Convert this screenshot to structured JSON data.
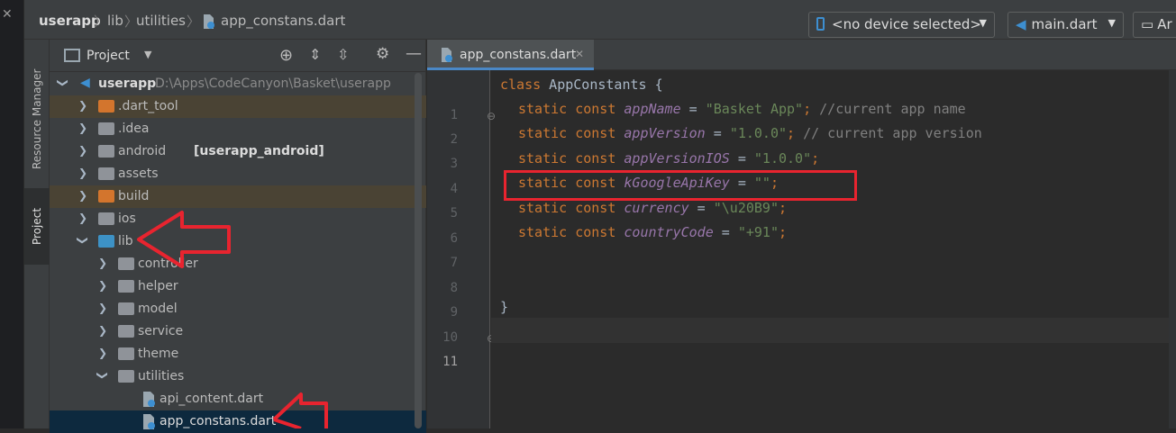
{
  "breadcrumb": {
    "items": [
      "userapp",
      "lib",
      "utilities",
      "app_constans.dart"
    ]
  },
  "toolbar": {
    "device_label": "<no device selected>",
    "config_label": "main.dart",
    "extra_label": "Ar"
  },
  "side_tabs": {
    "resource_manager": "Resource Manager",
    "project": "Project"
  },
  "project_panel": {
    "title": "Project",
    "root": {
      "name": "userapp",
      "path": "D:\\Apps\\CodeCanyon\\Basket\\userapp"
    },
    "items": [
      {
        "label": ".dart_tool",
        "suffix": ""
      },
      {
        "label": ".idea",
        "suffix": ""
      },
      {
        "label": "android",
        "suffix": "[userapp_android]"
      },
      {
        "label": "assets",
        "suffix": ""
      },
      {
        "label": "build",
        "suffix": ""
      },
      {
        "label": "ios",
        "suffix": ""
      },
      {
        "label": "lib",
        "suffix": ""
      },
      {
        "label": "controller",
        "suffix": ""
      },
      {
        "label": "helper",
        "suffix": ""
      },
      {
        "label": "model",
        "suffix": ""
      },
      {
        "label": "service",
        "suffix": ""
      },
      {
        "label": "theme",
        "suffix": ""
      },
      {
        "label": "utilities",
        "suffix": ""
      },
      {
        "label": "api_content.dart",
        "suffix": ""
      },
      {
        "label": "app_constans.dart",
        "suffix": ""
      }
    ]
  },
  "editor": {
    "tab_label": "app_constans.dart",
    "line_numbers": [
      "1",
      "2",
      "3",
      "4",
      "5",
      "6",
      "7",
      "8",
      "9",
      "10",
      "11"
    ],
    "code": {
      "l1_kw": "class",
      "l1_rest": " AppConstants {",
      "kw": "static const",
      "l2_name": "appName",
      "l2_val": "\"Basket App\"",
      "l2_cmt": "//current app name",
      "l3_name": "appVersion",
      "l3_val": "\"1.0.0\"",
      "l3_cmt": "// current app version",
      "l4_name": "appVersionIOS",
      "l4_val": "\"1.0.0\"",
      "l5_name": "kGoogleApiKey",
      "l5_val": "\"\"",
      "l6_name": "currency",
      "l6_val": "\"\\u20B9\"",
      "l7_name": "countryCode",
      "l7_val": "\"+91\"",
      "l10": "}",
      "eq": " = ",
      "semi": ";"
    }
  },
  "colors": {
    "annotation_red": "#e8242f",
    "selection": "#0d293e",
    "accent": "#4a88c7"
  }
}
